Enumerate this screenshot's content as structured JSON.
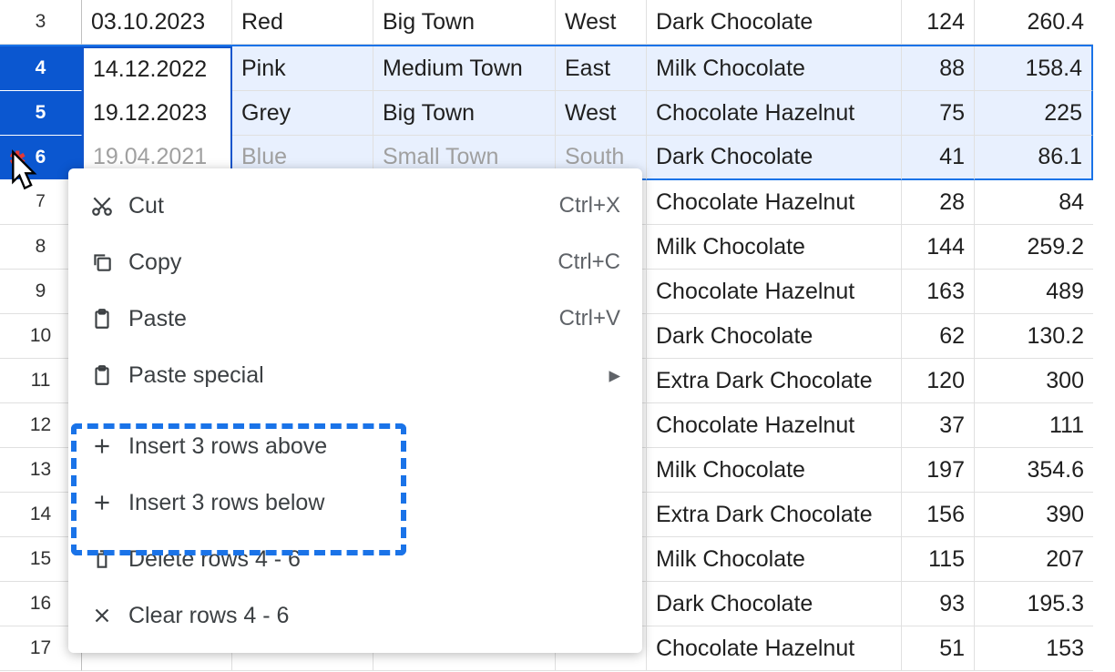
{
  "rows": {
    "3": {
      "date": "03.10.2023",
      "color": "Red",
      "town": "Big Town",
      "dir": "West",
      "prod": "Dark Chocolate",
      "n1": "124",
      "n2": "260.4"
    },
    "4": {
      "date": "14.12.2022",
      "color": "Pink",
      "town": "Medium Town",
      "dir": "East",
      "prod": "Milk Chocolate",
      "n1": "88",
      "n2": "158.4"
    },
    "5": {
      "date": "19.12.2023",
      "color": "Grey",
      "town": "Big Town",
      "dir": "West",
      "prod": "Chocolate Hazelnut",
      "n1": "75",
      "n2": "225"
    },
    "6": {
      "date": "19.04.2021",
      "color": "Blue",
      "town": "Small Town",
      "dir": "South",
      "prod": "Dark Chocolate",
      "n1": "41",
      "n2": "86.1"
    },
    "7": {
      "prod": "Chocolate Hazelnut",
      "n1": "28",
      "n2": "84"
    },
    "8": {
      "prod": "Milk Chocolate",
      "n1": "144",
      "n2": "259.2"
    },
    "9": {
      "prod": "Chocolate Hazelnut",
      "n1": "163",
      "n2": "489"
    },
    "10": {
      "prod": "Dark Chocolate",
      "n1": "62",
      "n2": "130.2"
    },
    "11": {
      "prod": "Extra Dark Chocolate",
      "n1": "120",
      "n2": "300"
    },
    "12": {
      "prod": "Chocolate Hazelnut",
      "n1": "37",
      "n2": "111"
    },
    "13": {
      "prod": "Milk Chocolate",
      "n1": "197",
      "n2": "354.6"
    },
    "14": {
      "prod": "Extra Dark Chocolate",
      "n1": "156",
      "n2": "390"
    },
    "15": {
      "prod": "Milk Chocolate",
      "n1": "115",
      "n2": "207"
    },
    "16": {
      "prod": "Dark Chocolate",
      "n1": "93",
      "n2": "195.3"
    },
    "17": {
      "prod": "Chocolate Hazelnut",
      "n1": "51",
      "n2": "153"
    }
  },
  "rowHeaders": {
    "3": "3",
    "4": "4",
    "5": "5",
    "6": "6",
    "7": "7",
    "8": "8",
    "9": "9",
    "10": "10",
    "11": "11",
    "12": "12",
    "13": "13",
    "14": "14",
    "15": "15",
    "16": "16",
    "17": "17"
  },
  "menu": {
    "cut": {
      "label": "Cut",
      "shortcut": "Ctrl+X"
    },
    "copy": {
      "label": "Copy",
      "shortcut": "Ctrl+C"
    },
    "paste": {
      "label": "Paste",
      "shortcut": "Ctrl+V"
    },
    "pasteSpecial": {
      "label": "Paste special"
    },
    "insertAbove": {
      "label": "Insert 3 rows above"
    },
    "insertBelow": {
      "label": "Insert 3 rows below"
    },
    "deleteRows": {
      "label": "Delete rows 4 - 6"
    },
    "clearRows": {
      "label": "Clear rows 4 - 6"
    }
  }
}
